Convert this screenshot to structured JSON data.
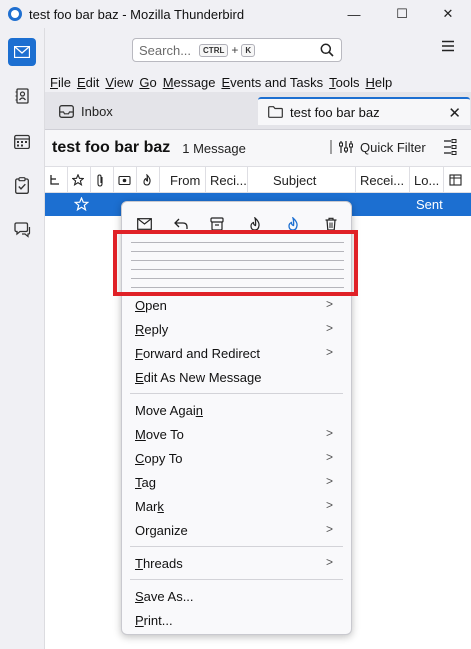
{
  "window": {
    "title": "test foo bar baz - Mozilla Thunderbird",
    "minimize": "—",
    "maximize": "☐",
    "close": "✕"
  },
  "toolbar": {
    "search_placeholder": "Search...",
    "kbd_ctrl": "CTRL",
    "kbd_plus": "+",
    "kbd_k": "K"
  },
  "menubar": [
    "File",
    "Edit",
    "View",
    "Go",
    "Message",
    "Events and Tasks",
    "Tools",
    "Help"
  ],
  "tabs": {
    "inbox": "Inbox",
    "active": "test foo bar baz",
    "close": "✕"
  },
  "header": {
    "folder_name": "test foo bar baz",
    "message_count": "1 Message",
    "quick_filter": "Quick Filter"
  },
  "columns": [
    "From",
    "Reci...",
    "Subject",
    "Recei...",
    "Lo..."
  ],
  "row": {
    "status": "Sent"
  },
  "context_menu": {
    "items": [
      {
        "label": "Open",
        "accel_index": 0,
        "submenu": true
      },
      {
        "label": "Reply",
        "accel_index": 0,
        "submenu": true
      },
      {
        "label": "Forward and Redirect",
        "accel_index": 0,
        "submenu": true
      },
      {
        "label": "Edit As New Message",
        "accel_index": 0,
        "submenu": false
      },
      {
        "label": "Move Again",
        "accel_index": 9,
        "submenu": false
      },
      {
        "label": "Move To",
        "accel_index": 0,
        "submenu": true
      },
      {
        "label": "Copy To",
        "accel_index": 0,
        "submenu": true
      },
      {
        "label": "Tag",
        "accel_index": 0,
        "submenu": true
      },
      {
        "label": "Mark",
        "accel_index": 3,
        "submenu": true
      },
      {
        "label": "Organize",
        "accel_index": -1,
        "submenu": true
      },
      {
        "label": "Threads",
        "accel_index": 0,
        "submenu": true
      },
      {
        "label": "Save As...",
        "accel_index": 0,
        "submenu": false
      },
      {
        "label": "Print...",
        "accel_index": 0,
        "submenu": false
      }
    ]
  },
  "colors": {
    "accent": "#1c6fd1",
    "highlight_box": "#e02127"
  }
}
